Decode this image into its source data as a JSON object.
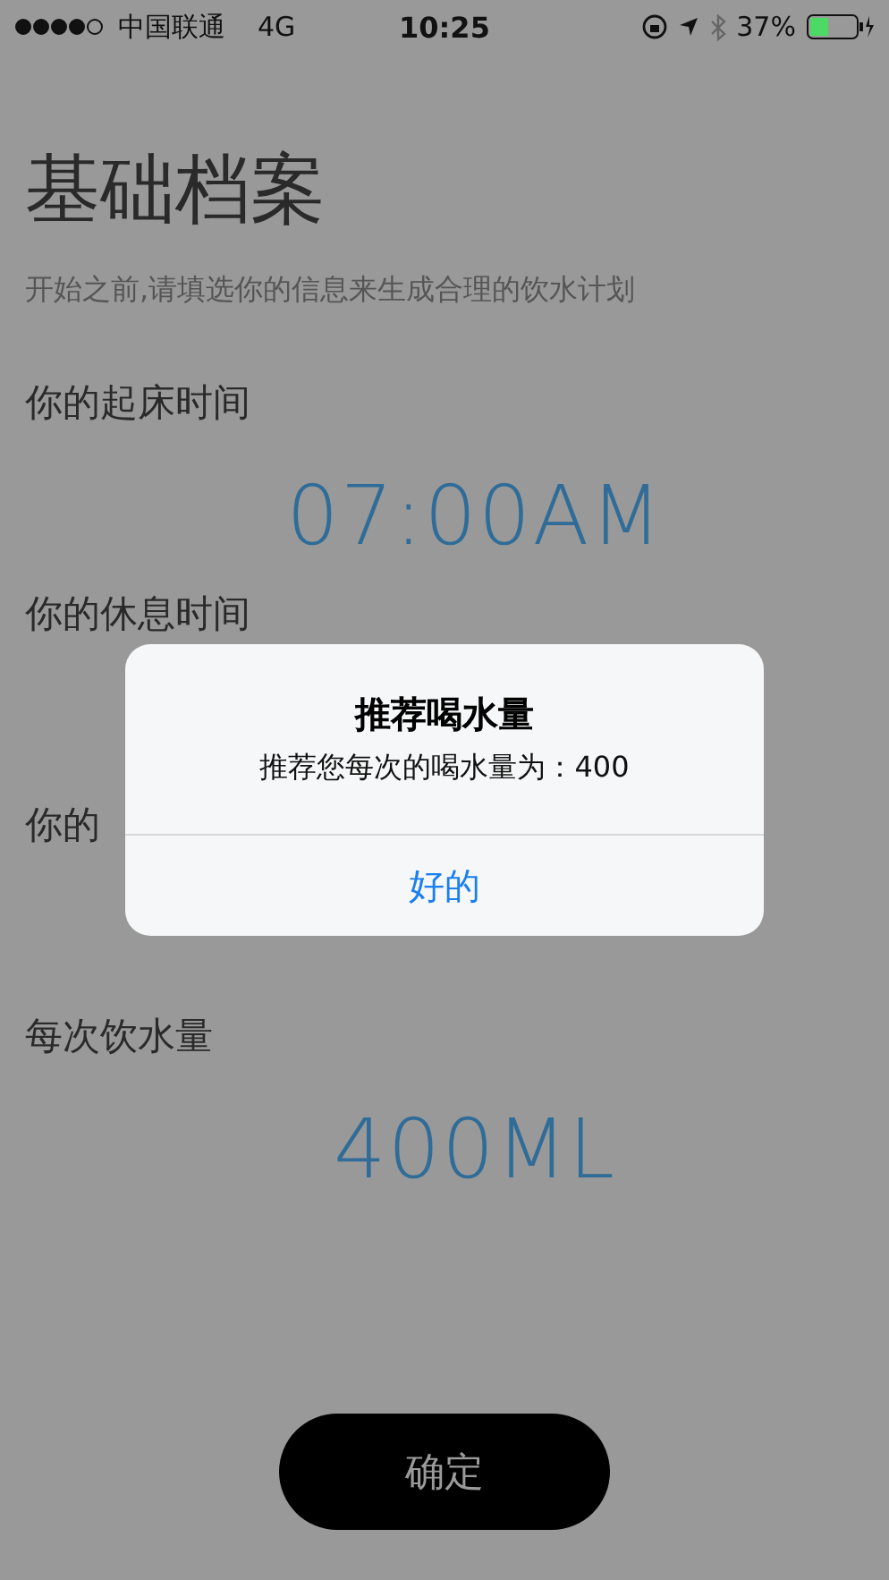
{
  "status_bar": {
    "carrier": "中国联通",
    "network": "4G",
    "time": "10:25",
    "battery": "37%"
  },
  "title": "基础档案",
  "subtitle": "开始之前,请填选你的信息来生成合理的饮水计划",
  "fields": [
    {
      "label": "你的起床时间",
      "value": "07:00AM"
    },
    {
      "label": "你的休息时间"
    },
    {
      "label": "你的"
    },
    {
      "label": "每次饮水量",
      "value": "400ML"
    }
  ],
  "confirm_button": "确定",
  "alert": {
    "title": "推荐喝水量",
    "message": "推荐您每次的喝水量为：400",
    "button": "好的"
  }
}
